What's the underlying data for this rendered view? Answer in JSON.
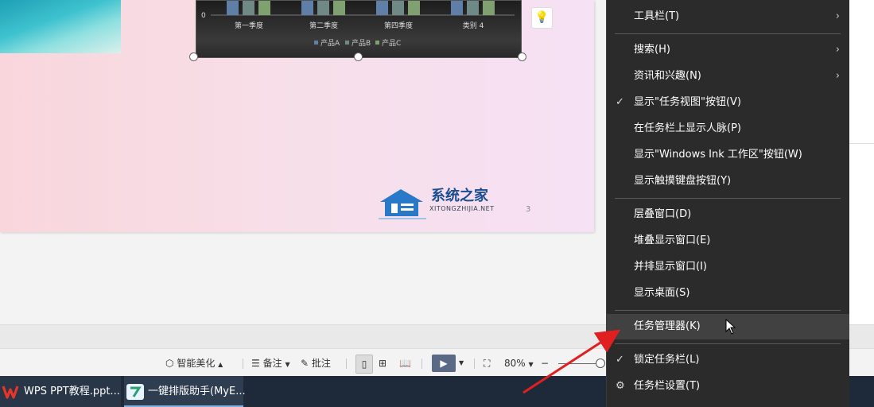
{
  "slide": {
    "chart": {
      "zero_label": "0",
      "categories": [
        "第一季度",
        "第二季度",
        "第四季度",
        "类别 4"
      ],
      "legend": [
        "产品A",
        "产品B",
        "产品C"
      ],
      "series_colors": [
        "#5f7fa8",
        "#6f8a86",
        "#7fa06f"
      ]
    },
    "logo_text": "系统之家",
    "logo_subtext": "XITONGZHIJIA.NET",
    "page_number": "3"
  },
  "status_bar": {
    "beautify_label": "智能美化",
    "notes_label": "备注",
    "comment_label": "批注",
    "zoom": "80%",
    "zoom_out": "−"
  },
  "taskbar": {
    "apps": [
      {
        "label": "WPS PPT教程.ppt..."
      },
      {
        "label": "一键排版助手(MyE..."
      }
    ]
  },
  "context_menu": {
    "items": [
      {
        "label": "工具栏(T)",
        "submenu": true,
        "checked": false
      },
      {
        "label": "搜索(H)",
        "submenu": true,
        "checked": false
      },
      {
        "label": "资讯和兴趣(N)",
        "submenu": true,
        "checked": false
      },
      {
        "label": "显示\"任务视图\"按钮(V)",
        "submenu": false,
        "checked": true
      },
      {
        "label": "在任务栏上显示人脉(P)",
        "submenu": false,
        "checked": false
      },
      {
        "label": "显示\"Windows Ink 工作区\"按钮(W)",
        "submenu": false,
        "checked": false
      },
      {
        "label": "显示触摸键盘按钮(Y)",
        "submenu": false,
        "checked": false
      },
      {
        "label": "层叠窗口(D)",
        "submenu": false,
        "checked": false
      },
      {
        "label": "堆叠显示窗口(E)",
        "submenu": false,
        "checked": false
      },
      {
        "label": "并排显示窗口(I)",
        "submenu": false,
        "checked": false
      },
      {
        "label": "显示桌面(S)",
        "submenu": false,
        "checked": false
      },
      {
        "label": "任务管理器(K)",
        "submenu": false,
        "checked": false,
        "highlighted": true
      },
      {
        "label": "锁定任务栏(L)",
        "submenu": false,
        "checked": true
      },
      {
        "label": "任务栏设置(T)",
        "submenu": false,
        "checked": false,
        "icon": "gear-icon"
      }
    ],
    "check_glyph": "✓",
    "chevron_glyph": "›",
    "gear_glyph": "⚙"
  },
  "colors": {
    "menu_bg": "#2b2b2b",
    "menu_highlight": "#414141",
    "annotation_arrow": "#e02020",
    "taskbar_bg": "#1e2a3a"
  }
}
